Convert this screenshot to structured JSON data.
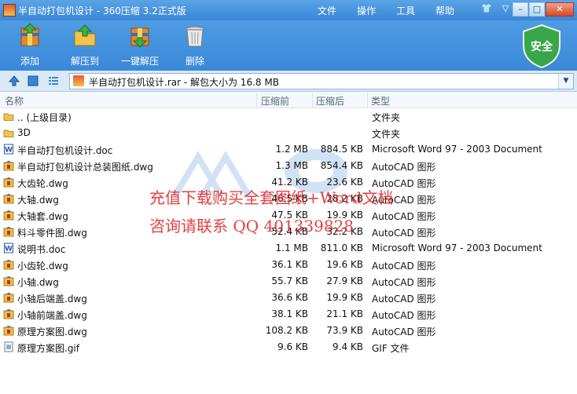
{
  "window": {
    "title": "半自动打包机设计 - 360压缩 3.2正式版",
    "menu": [
      "文件",
      "操作",
      "工具",
      "帮助"
    ]
  },
  "toolbar": {
    "items": [
      {
        "label": "添加",
        "icon": "add-archive-icon"
      },
      {
        "label": "解压到",
        "icon": "extract-to-icon"
      },
      {
        "label": "一键解压",
        "icon": "one-click-extract-icon"
      },
      {
        "label": "删除",
        "icon": "trash-icon"
      }
    ],
    "security_badge": "安全"
  },
  "pathbar": {
    "path": "半自动打包机设计.rar - 解包大小为 16.8 MB"
  },
  "columns": {
    "name": "名称",
    "size": "压缩前",
    "packed": "压缩后",
    "type": "类型"
  },
  "files": [
    {
      "name": ".. (上级目录)",
      "size": "",
      "packed": "",
      "type": "文件夹",
      "icon": "folder-icon"
    },
    {
      "name": "3D",
      "size": "",
      "packed": "",
      "type": "文件夹",
      "icon": "folder-icon"
    },
    {
      "name": "半自动打包机设计.doc",
      "size": "1.2 MB",
      "packed": "884.5 KB",
      "type": "Microsoft Word 97 - 2003 Document",
      "icon": "word-doc-icon"
    },
    {
      "name": "半自动打包机设计总装图纸.dwg",
      "size": "1.3 MB",
      "packed": "854.4 KB",
      "type": "AutoCAD 图形",
      "icon": "dwg-file-icon"
    },
    {
      "name": "大齿轮.dwg",
      "size": "41.2 KB",
      "packed": "23.6 KB",
      "type": "AutoCAD 图形",
      "icon": "dwg-file-icon"
    },
    {
      "name": "大轴.dwg",
      "size": "46.5 KB",
      "packed": "28.2 KB",
      "type": "AutoCAD 图形",
      "icon": "dwg-file-icon"
    },
    {
      "name": "大轴套.dwg",
      "size": "47.5 KB",
      "packed": "19.9 KB",
      "type": "AutoCAD 图形",
      "icon": "dwg-file-icon"
    },
    {
      "name": "料斗零件图.dwg",
      "size": "52.4 KB",
      "packed": "32.2 KB",
      "type": "AutoCAD 图形",
      "icon": "dwg-file-icon"
    },
    {
      "name": "说明书.doc",
      "size": "1.1 MB",
      "packed": "811.0 KB",
      "type": "Microsoft Word 97 - 2003 Document",
      "icon": "word-doc-icon"
    },
    {
      "name": "小齿轮.dwg",
      "size": "36.1 KB",
      "packed": "19.6 KB",
      "type": "AutoCAD 图形",
      "icon": "dwg-file-icon"
    },
    {
      "name": "小轴.dwg",
      "size": "55.7 KB",
      "packed": "27.9 KB",
      "type": "AutoCAD 图形",
      "icon": "dwg-file-icon"
    },
    {
      "name": "小轴后端盖.dwg",
      "size": "36.6 KB",
      "packed": "19.9 KB",
      "type": "AutoCAD 图形",
      "icon": "dwg-file-icon"
    },
    {
      "name": "小轴前端盖.dwg",
      "size": "38.1 KB",
      "packed": "21.1 KB",
      "type": "AutoCAD 图形",
      "icon": "dwg-file-icon"
    },
    {
      "name": "原理方案图.dwg",
      "size": "108.2 KB",
      "packed": "73.9 KB",
      "type": "AutoCAD 图形",
      "icon": "dwg-file-icon"
    },
    {
      "name": "原理方案图.gif",
      "size": "9.6 KB",
      "packed": "9.4 KB",
      "type": "GIF 文件",
      "icon": "gif-file-icon"
    }
  ],
  "watermark": {
    "line1": "充值下载购买全套图纸+Word文档",
    "line2": "咨询请联系 QQ 401339828"
  }
}
